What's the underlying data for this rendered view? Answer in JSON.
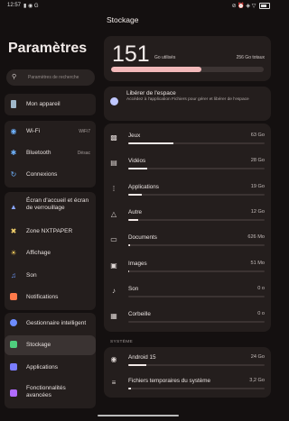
{
  "status_bar": {
    "time": "12:57",
    "left_icons": "▮ ◉ G",
    "right_icons": "⊘ ⏰ ◈ ▽",
    "battery_icon": "battery-icon"
  },
  "settings": {
    "title": "Paramètres",
    "search_placeholder": "Paramètres de recherche",
    "groups": [
      {
        "items": [
          {
            "label": "Mon appareil",
            "icon": "phone-icon"
          }
        ]
      },
      {
        "items": [
          {
            "label": "Wi-Fi",
            "value": "WiFi7",
            "icon": "wifi-icon"
          },
          {
            "label": "Bluetooth",
            "value": "Désac",
            "icon": "bluetooth-icon"
          },
          {
            "label": "Connexions",
            "icon": "connections-icon"
          }
        ]
      },
      {
        "items": [
          {
            "label": "Écran d'accueil et écran de verrouillage",
            "icon": "home-screen-icon"
          },
          {
            "label": "Zone NXTPAPER",
            "icon": "nxtpaper-icon"
          },
          {
            "label": "Affichage",
            "icon": "display-icon"
          },
          {
            "label": "Son",
            "icon": "sound-icon"
          },
          {
            "label": "Notifications",
            "icon": "notifications-icon"
          }
        ]
      },
      {
        "items": [
          {
            "label": "Gestionnaire intelligent",
            "icon": "smart-manager-icon"
          },
          {
            "label": "Stockage",
            "icon": "storage-icon",
            "selected": true
          },
          {
            "label": "Applications",
            "icon": "apps-icon"
          },
          {
            "label": "Fonctionnalités avancées",
            "icon": "advanced-icon"
          }
        ]
      }
    ]
  },
  "storage": {
    "title": "Stockage",
    "used_value": "151",
    "used_label": "Go utilisés",
    "total_label": "256 Go totaux",
    "used_fraction": 0.59,
    "free_space": {
      "title": "Libérer de l'espace",
      "subtitle": "Accédez à l'application Fichiers pour gérer et libérer de l'espace"
    },
    "categories": [
      {
        "name": "Jeux",
        "size": "63 Go",
        "fraction": 0.33,
        "icon": "games-icon"
      },
      {
        "name": "Vidéos",
        "size": "28 Go",
        "fraction": 0.14,
        "icon": "videos-icon"
      },
      {
        "name": "Applications",
        "size": "19 Go",
        "fraction": 0.1,
        "icon": "apps-grid-icon"
      },
      {
        "name": "Autre",
        "size": "12 Go",
        "fraction": 0.07,
        "icon": "other-icon"
      },
      {
        "name": "Documents",
        "size": "626 Mo",
        "fraction": 0.01,
        "icon": "folder-icon"
      },
      {
        "name": "Images",
        "size": "51 Mo",
        "fraction": 0.005,
        "icon": "images-icon"
      },
      {
        "name": "Son",
        "size": "0 o",
        "fraction": 0.0,
        "icon": "music-icon"
      },
      {
        "name": "Corbeille",
        "size": "0 o",
        "fraction": 0.0,
        "icon": "trash-icon"
      }
    ],
    "system_section": "SYSTÈME",
    "system": [
      {
        "name": "Android 15",
        "size": "24 Go",
        "fraction": 0.13,
        "icon": "android-icon"
      },
      {
        "name": "Fichiers temporaires du système",
        "size": "3,2 Go",
        "fraction": 0.02,
        "icon": "database-icon"
      }
    ]
  },
  "colors": {
    "accent": "#f2b9ba",
    "background": "#141010",
    "card": "#241e1d"
  }
}
